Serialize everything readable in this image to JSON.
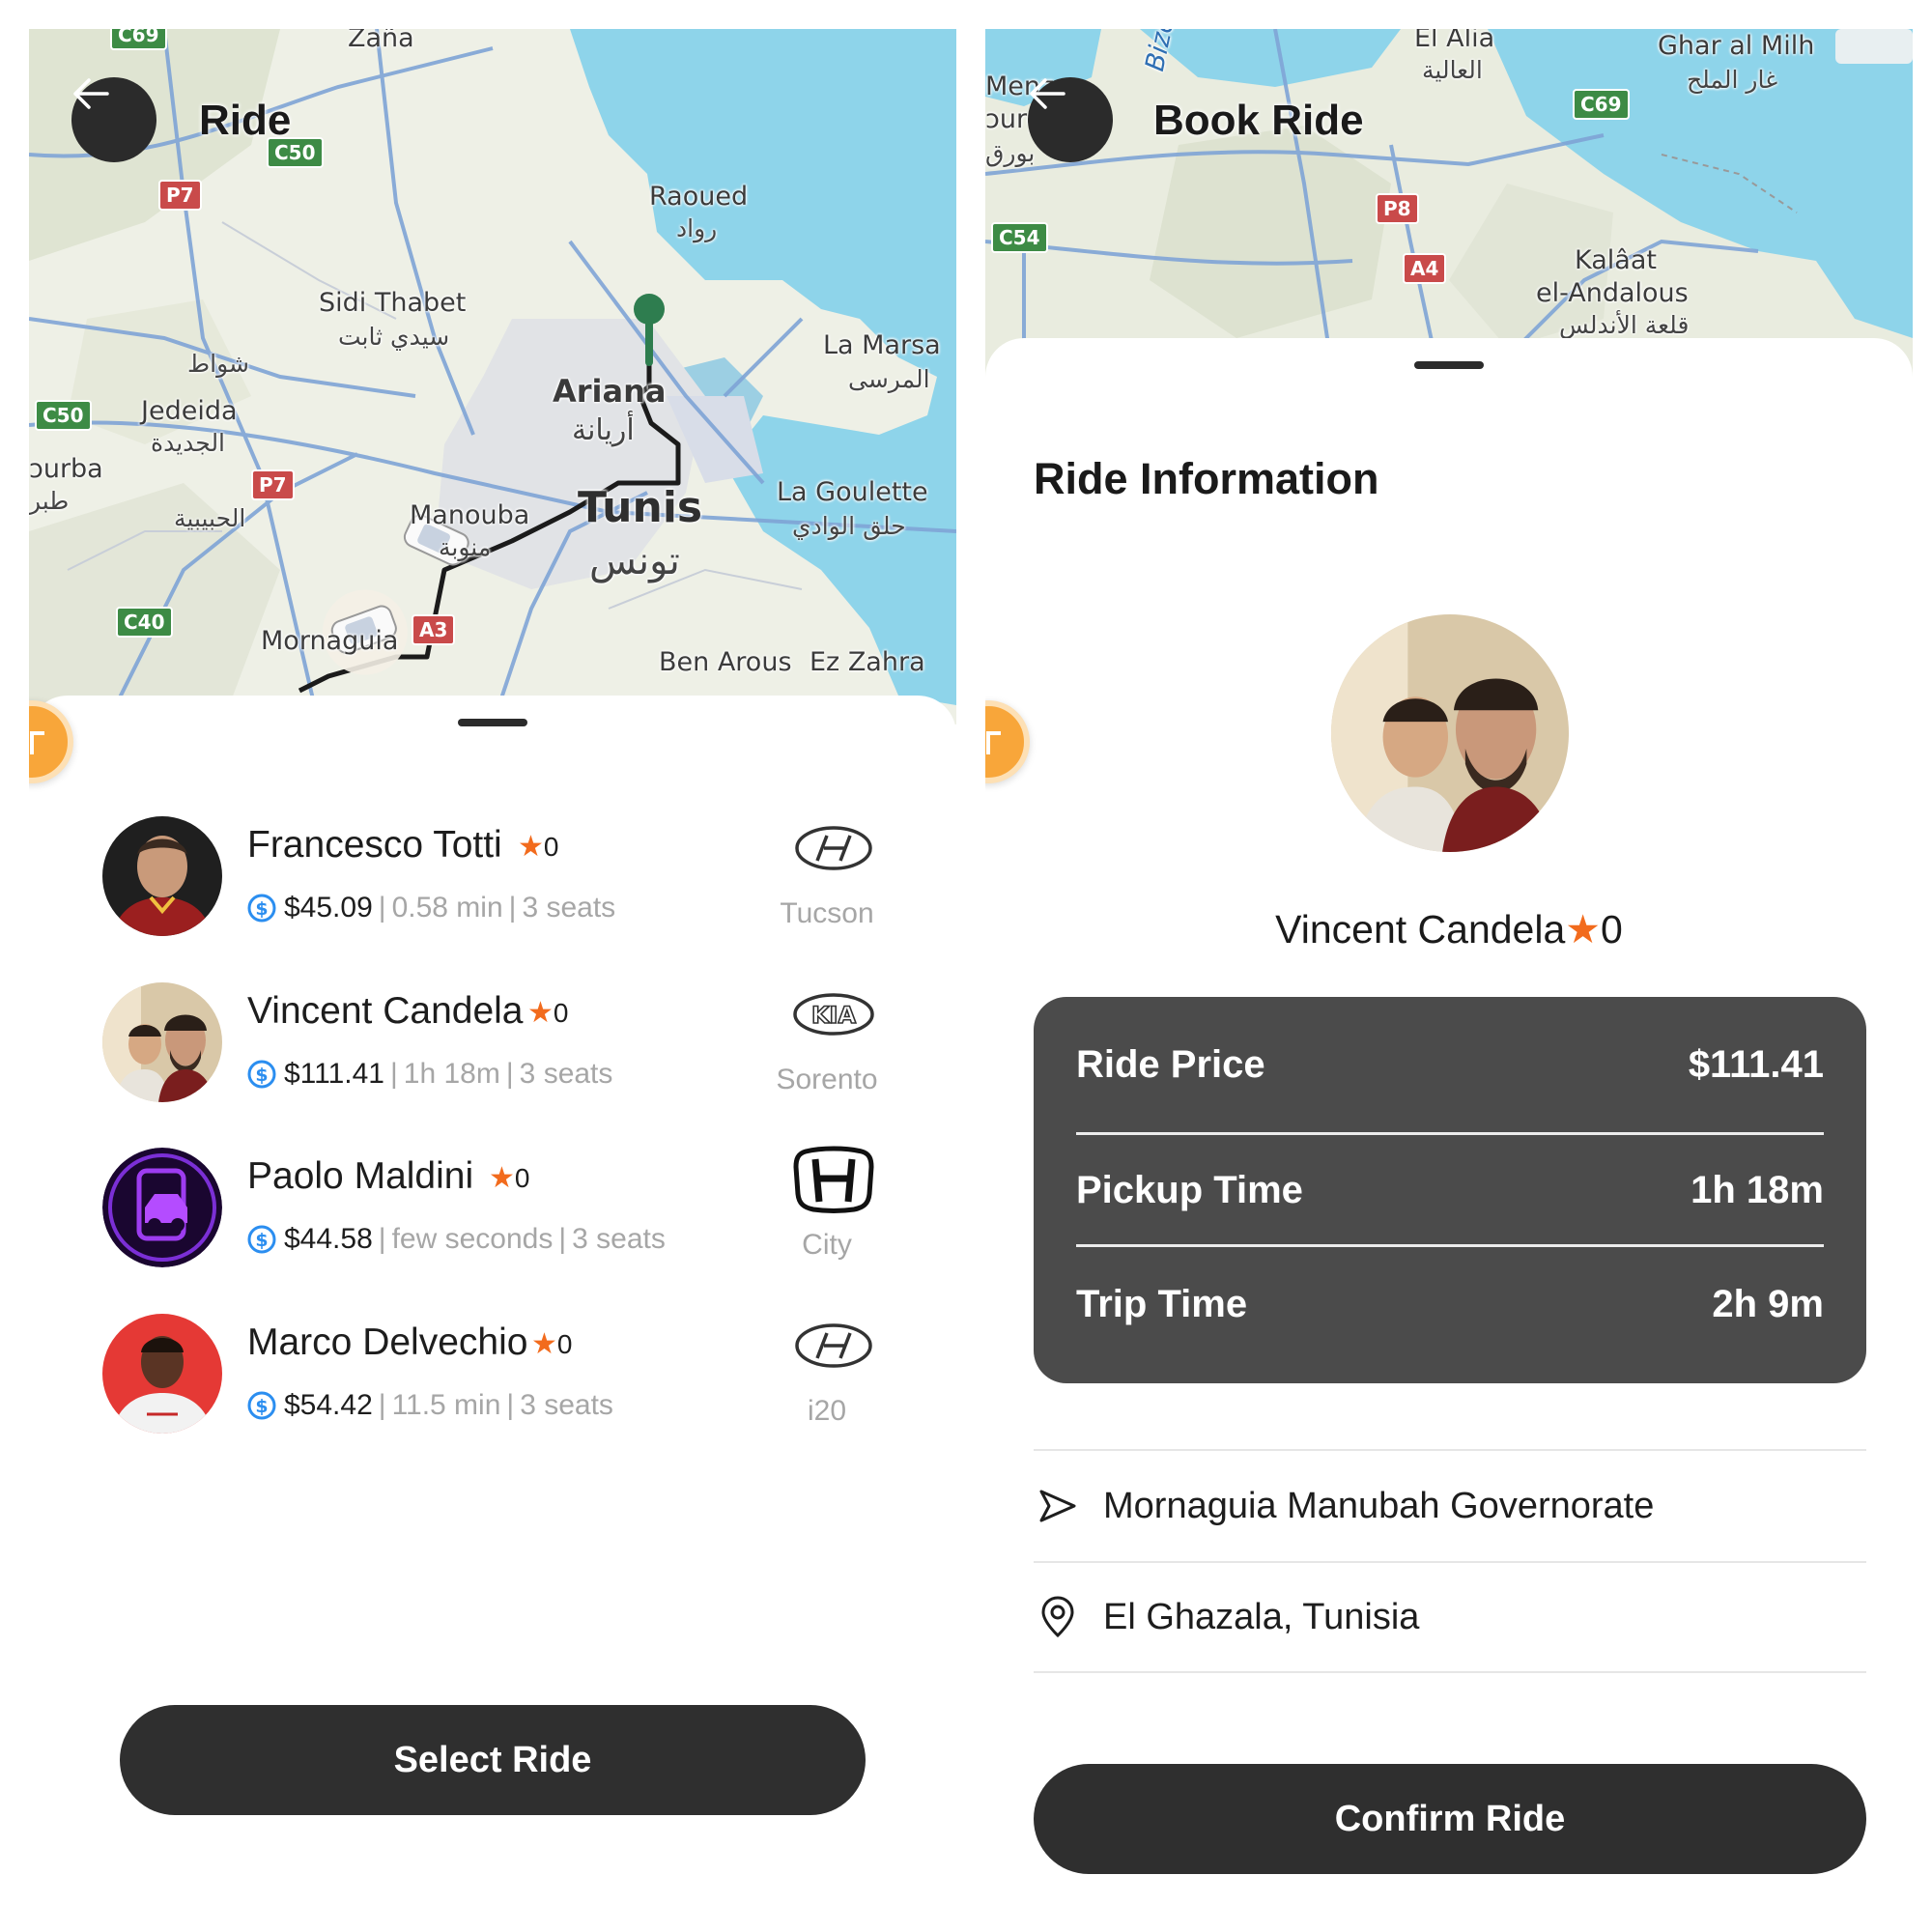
{
  "left_screen": {
    "title": "Ride",
    "map_labels": {
      "zana": "Zaña",
      "raoued": "Raoued",
      "raoued_ar": "رواد",
      "sidi_thabet": "Sidi Thabet",
      "sidi_thabet_ar": "سيدي ثابت",
      "shawat_ar": "شواط",
      "jedeida": "Jedeida",
      "jedeida_ar": "الجديدة",
      "tebourba": "ɔurba",
      "tebourba_ar": "طبر",
      "habibia_ar": "الحبيبية",
      "ariana": "Ariana",
      "ariana_ar": "أريانة",
      "la_marsa": "La Marsa",
      "la_marsa_ar": "المرسى",
      "manouba": "Manouba",
      "manouba_ar": "منوبة",
      "tunis": "Tunis",
      "tunis_ar": "تونس",
      "la_goulette": "La Goulette",
      "la_goulette_ar": "حلق الوادي",
      "mornaguia": "Mornaguia",
      "ben_arous": "Ben Arous",
      "ez_zahra": "Ez Zahra"
    },
    "road_badges": {
      "c69": "C69",
      "c50_top": "C50",
      "p7_top": "P7",
      "c50_left": "C50",
      "p7_mid": "P7",
      "c40": "C40",
      "a3": "A3"
    },
    "rides": [
      {
        "driver": "Francesco Totti",
        "rating": "0",
        "price": "$45.09",
        "eta": "0.58 min",
        "seats": "3 seats",
        "brand_icon": "hyundai-logo-icon",
        "model": "Tucson"
      },
      {
        "driver": "Vincent Candela",
        "rating": "0",
        "price": "$111.41",
        "eta": "1h 18m",
        "seats": "3 seats",
        "brand_icon": "kia-logo-icon",
        "model": "Sorento"
      },
      {
        "driver": "Paolo Maldini",
        "rating": "0",
        "price": "$44.58",
        "eta": "few seconds",
        "seats": "3 seats",
        "brand_icon": "honda-logo-icon",
        "model": "City"
      },
      {
        "driver": "Marco Delvechio",
        "rating": "0",
        "price": "$54.42",
        "eta": "11.5 min",
        "seats": "3 seats",
        "brand_icon": "hyundai-logo-icon",
        "model": "i20"
      }
    ],
    "separator": "|",
    "select_button": "Select Ride"
  },
  "right_screen": {
    "title": "Book Ride",
    "map_labels": {
      "el_alia": "El Alia",
      "el_alia_ar": "العالية",
      "ghar_al_milh": "Ghar al Milh",
      "ghar_al_milh_ar": "غار الملح",
      "menzel": "Menz",
      "bourguiba": "ɔurg",
      "bourguiba_ar": "بورق",
      "bizerte": "Bizer",
      "kalaat": "Kalâat",
      "el_andalous": "el-Andalous",
      "el_andalous_ar": "قلعة الأندلس"
    },
    "road_badges": {
      "c69": "C69",
      "p8": "P8",
      "c54": "C54",
      "a4": "A4"
    },
    "section_title": "Ride Information",
    "driver": {
      "name": "Vincent Candela",
      "rating": "0"
    },
    "info": [
      {
        "label": "Ride Price",
        "value": "$111.41"
      },
      {
        "label": "Pickup Time",
        "value": "1h 18m"
      },
      {
        "label": "Trip Time",
        "value": "2h 9m"
      }
    ],
    "pickup": "Mornaguia Manubah Governorate",
    "destination": "El Ghazala, Tunisia",
    "confirm_button": "Confirm Ride"
  },
  "colors": {
    "accent_star": "#f26b1d",
    "button_dark": "#2f2f2f",
    "card_dark": "#4b4b4b",
    "fab_orange": "#f8a63a",
    "price_icon_blue": "#2b8ef0",
    "sea": "#8ed4ea",
    "land": "#eef0e6",
    "route": "#1b1b1b",
    "pin": "#2e7d4f"
  }
}
